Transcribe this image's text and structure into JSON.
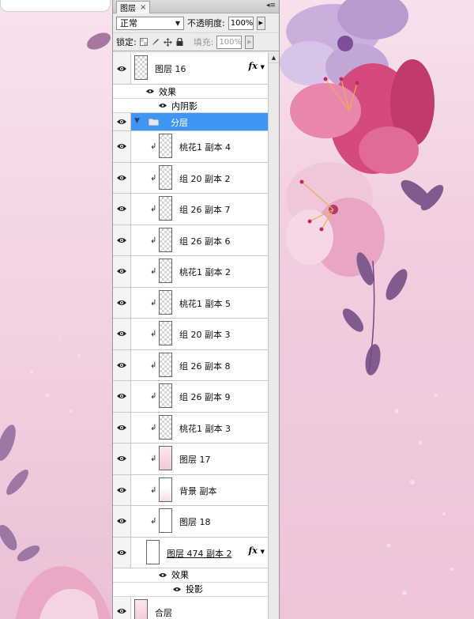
{
  "panel": {
    "tab_label": "图层",
    "tab_close": "×",
    "menu_glyph": "◂≡",
    "blend_mode": "正常",
    "opacity_label": "不透明度:",
    "opacity_value": "100%",
    "lock_label": "锁定:",
    "fill_label": "填充:",
    "fill_value": "100%"
  },
  "layers": {
    "layer16": {
      "name": "图层 16",
      "effects_label": "效果",
      "effect1": "内阴影"
    },
    "group": {
      "name": "分层"
    },
    "children": [
      {
        "name": "桃花1 副本 4",
        "thumb": "checker"
      },
      {
        "name": "组 20 副本 2",
        "thumb": "checker"
      },
      {
        "name": "组 26 副本 7",
        "thumb": "checker"
      },
      {
        "name": "组 26 副本 6",
        "thumb": "checker"
      },
      {
        "name": "桃花1 副本 2",
        "thumb": "checker"
      },
      {
        "name": "桃花1 副本 5",
        "thumb": "checker"
      },
      {
        "name": "组 20 副本 3",
        "thumb": "checker"
      },
      {
        "name": "组 26 副本 8",
        "thumb": "checker"
      },
      {
        "name": "组 26 副本 9",
        "thumb": "checker"
      },
      {
        "name": "桃花1 副本 3",
        "thumb": "checker"
      },
      {
        "name": "图层 17",
        "thumb": "pink"
      },
      {
        "name": "背景 副本",
        "thumb": "pinkwhite"
      },
      {
        "name": "图层 18",
        "thumb": "white"
      }
    ],
    "layer474": {
      "name": "图层 474 副本 2",
      "effects_label": "效果",
      "effect1": "投影"
    },
    "merged": {
      "name": "合层"
    }
  },
  "colors": {
    "selection": "#3f96f2",
    "canvas_pink": "#f1cde0"
  },
  "icons": [
    "eye-icon",
    "folder-icon",
    "clip-arrow-icon",
    "fx-icon",
    "lock-icon",
    "move-icon",
    "brush-icon"
  ]
}
